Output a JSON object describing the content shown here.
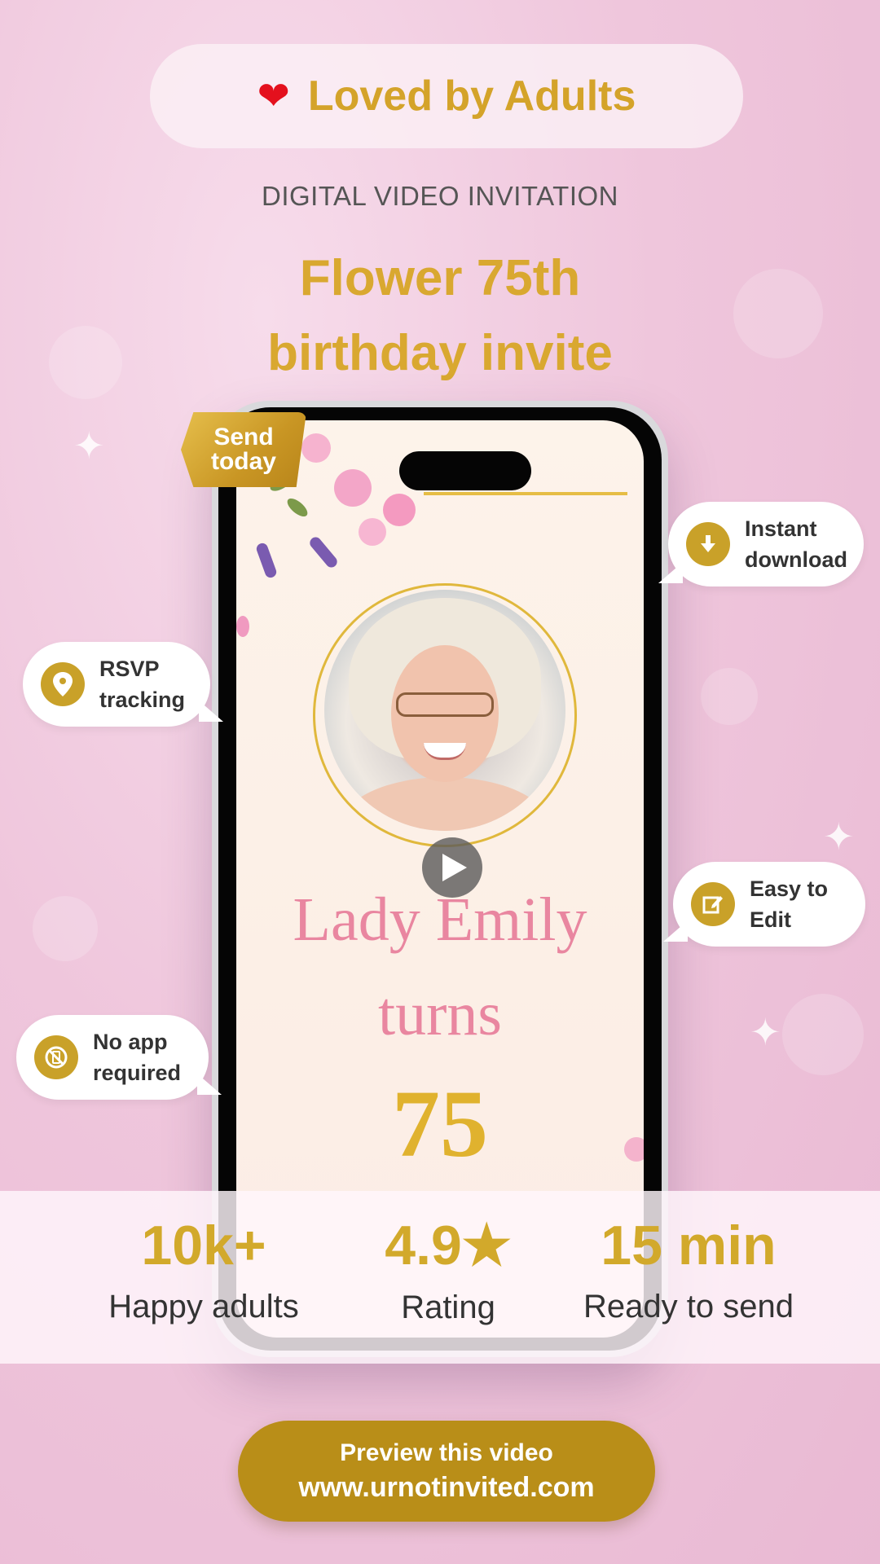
{
  "header": {
    "pill_icon": "heart-icon",
    "pill_text": "Loved by Adults",
    "subtitle": "DIGITAL VIDEO INVITATION",
    "title_line1": "Flower 75th",
    "title_line2": "birthday invite"
  },
  "badge": {
    "line1": "Send",
    "line2": "today"
  },
  "invitation": {
    "name": "Lady Emily",
    "turns": "turns",
    "age": "75"
  },
  "features": {
    "instant_download": {
      "line1": "Instant",
      "line2": "download",
      "icon": "download-icon"
    },
    "rsvp_tracking": {
      "line1": "RSVP",
      "line2": "tracking",
      "icon": "location-pin-icon"
    },
    "easy_to_edit": {
      "line1": "Easy to",
      "line2": "Edit",
      "icon": "edit-icon"
    },
    "no_app_required": {
      "line1": "No app",
      "line2": "required",
      "icon": "no-phone-icon"
    }
  },
  "stats": [
    {
      "value": "10k+",
      "caption": "Happy adults"
    },
    {
      "value": "4.9★",
      "caption": "Rating"
    },
    {
      "value": "15 min",
      "caption": "Ready to send"
    }
  ],
  "cta": {
    "line1": "Preview this video",
    "line2": "www.urnotinvited.com"
  },
  "colors": {
    "gold": "#d9a830",
    "cta_gold": "#b98e18",
    "pink_text": "#e986a0",
    "background_pink": "#efc6dc"
  }
}
